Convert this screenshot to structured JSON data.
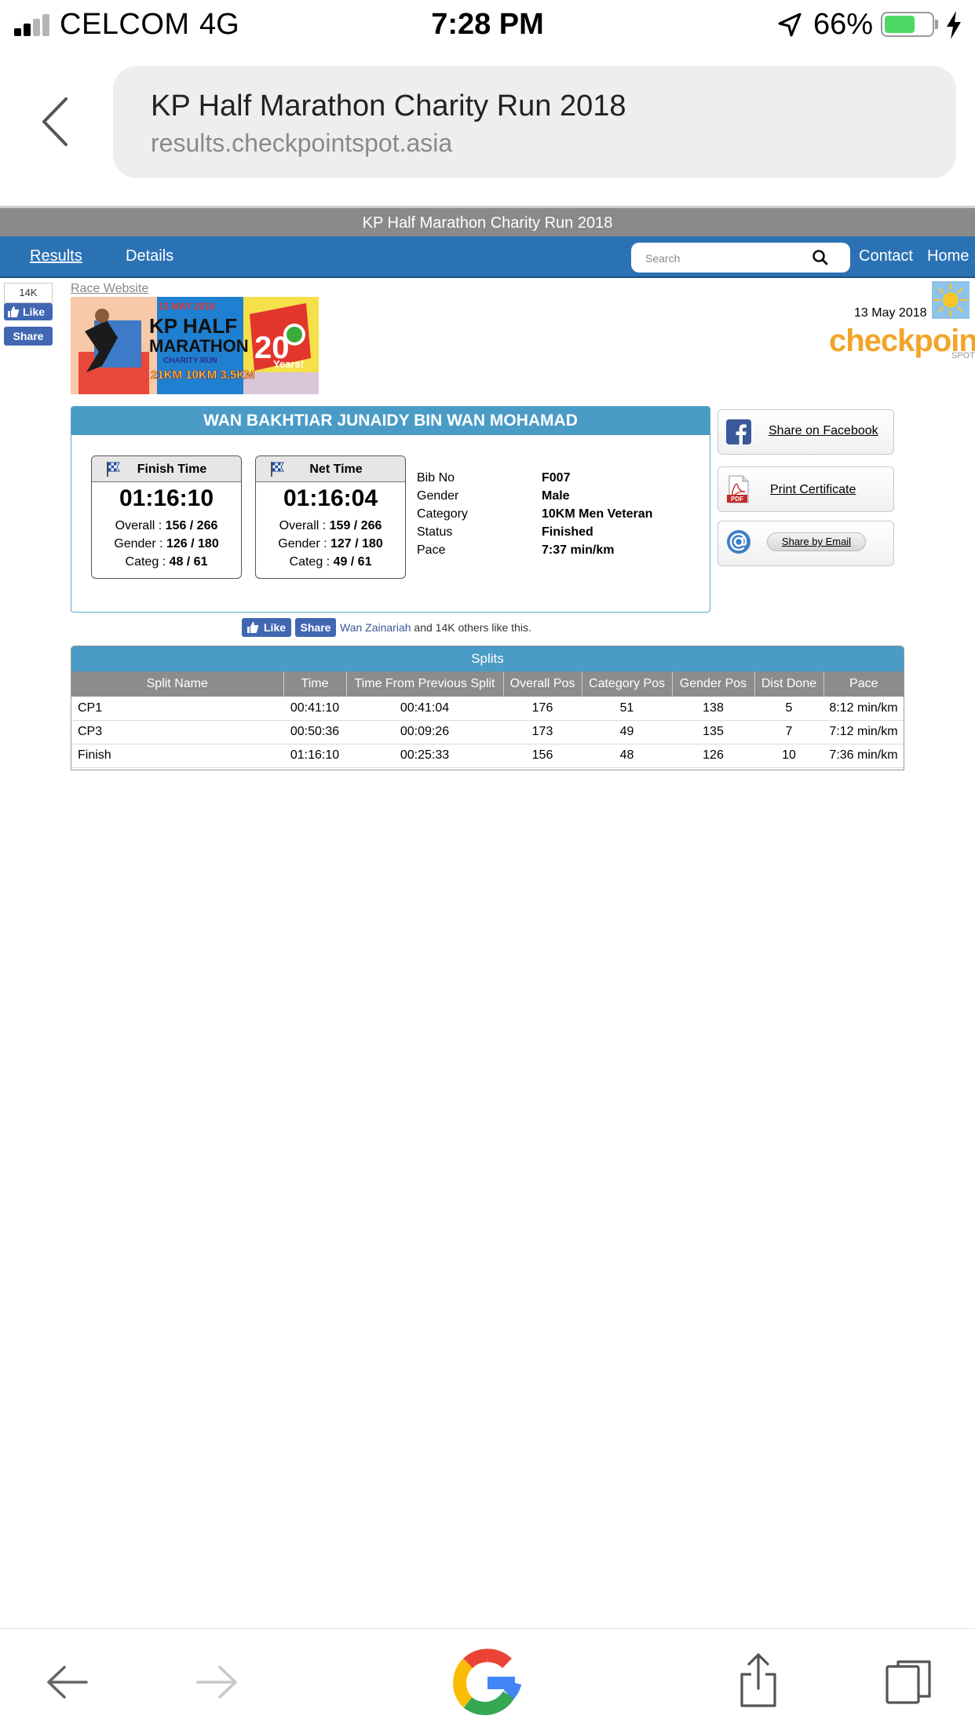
{
  "status_bar": {
    "carrier": "CELCOM",
    "network": "4G",
    "time": "7:28 PM",
    "battery": "66%",
    "battery_level": 0.66,
    "icons": [
      "signal-icon",
      "location-icon",
      "battery-icon",
      "charging-icon"
    ]
  },
  "browser": {
    "page_title": "KP Half Marathon Charity Run 2018",
    "url": "results.checkpointspot.asia"
  },
  "site": {
    "title": "KP Half Marathon Charity Run 2018",
    "nav": {
      "results": "Results",
      "details": "Details",
      "contact": "Contact",
      "home": "Home"
    },
    "search_placeholder": "Search"
  },
  "facebook": {
    "count": "14K",
    "like_label": "Like",
    "share_label": "Share",
    "liker_name": "Wan Zainariah",
    "likers_suffix": " and 14K others like this."
  },
  "race": {
    "website_link": "Race Website",
    "date": "13 May 2018",
    "banner": {
      "date_text": "13 MAY 2018",
      "line1": "KP HALF",
      "line2": "MARATHON",
      "line3": "CHARITY RUN",
      "distances": "21KM 10KM 3.5KM",
      "anniversary_number": "20",
      "anniversary_word": "Years!"
    },
    "logo_text": "checkpoint",
    "logo_sub": "SPOT"
  },
  "athlete": {
    "name": "WAN BAKHTIAR JUNAIDY BIN WAN MOHAMAD",
    "finish": {
      "label": "Finish Time",
      "time": "01:16:10",
      "overall_label": "Overall : ",
      "overall": "156 / 266",
      "gender_label": "Gender : ",
      "gender": "126 / 180",
      "categ_label": "Categ : ",
      "categ": "48 / 61"
    },
    "net": {
      "label": "Net Time",
      "time": "01:16:04",
      "overall_label": "Overall : ",
      "overall": "159 / 266",
      "gender_label": "Gender : ",
      "gender": "127 / 180",
      "categ_label": "Categ : ",
      "categ": "49 / 61"
    },
    "info": [
      {
        "label": "Bib No",
        "value": "F007"
      },
      {
        "label": "Gender",
        "value": "Male"
      },
      {
        "label": "Category",
        "value": "10KM Men Veteran"
      },
      {
        "label": "Status",
        "value": "Finished"
      },
      {
        "label": "Pace",
        "value": "7:37 min/km"
      }
    ]
  },
  "share": {
    "facebook": "Share on Facebook",
    "certificate": "Print Certificate",
    "pdf_badge": "PDF",
    "email": "Share by Email"
  },
  "splits": {
    "title": "Splits",
    "headers": [
      "Split Name",
      "Time",
      "Time From Previous Split",
      "Overall Pos",
      "Category Pos",
      "Gender Pos",
      "Dist Done",
      "Pace"
    ],
    "rows": [
      [
        "CP1",
        "00:41:10",
        "00:41:04",
        "176",
        "51",
        "138",
        "5",
        "8:12 min/km"
      ],
      [
        "CP3",
        "00:50:36",
        "00:09:26",
        "173",
        "49",
        "135",
        "7",
        "7:12 min/km"
      ],
      [
        "Finish",
        "01:16:10",
        "00:25:33",
        "156",
        "48",
        "126",
        "10",
        "7:36 min/km"
      ]
    ]
  },
  "toolbar": {
    "icons": [
      "back-arrow-icon",
      "forward-arrow-icon",
      "google-icon",
      "share-icon",
      "tabs-icon"
    ]
  },
  "colors": {
    "nav_blue": "#2b72b5",
    "header_blue": "#4a9bc6",
    "facebook_blue": "#4267b2",
    "checkpoint_orange": "#f2a42a",
    "battery_green": "#4cd964"
  }
}
